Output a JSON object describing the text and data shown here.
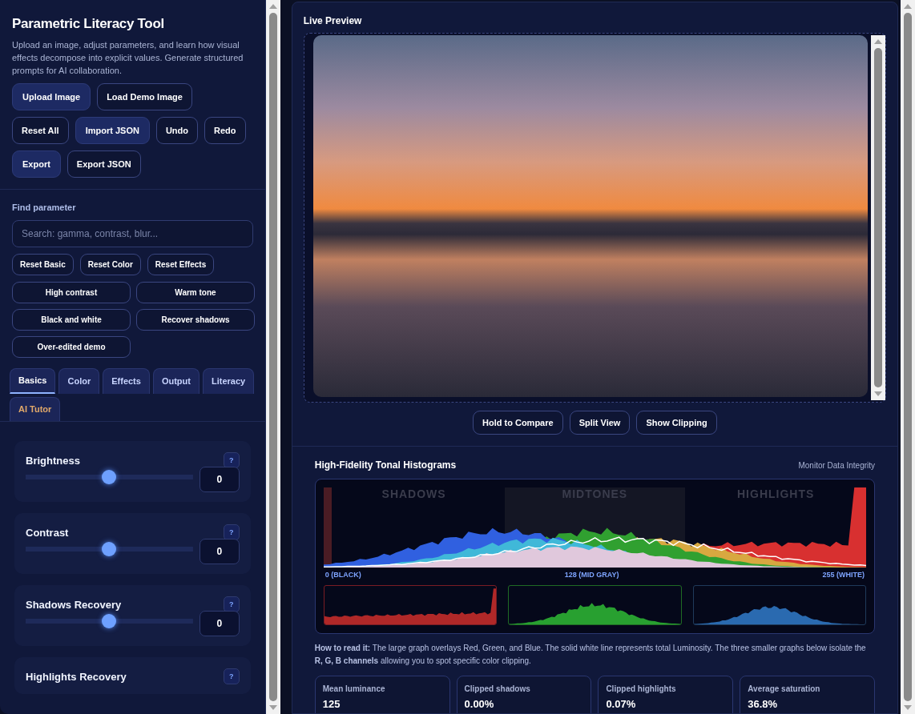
{
  "sidebar": {
    "title": "Parametric Literacy Tool",
    "description": "Upload an image, adjust parameters, and learn how visual effects decompose into explicit values. Generate structured prompts for AI collaboration.",
    "action_rows": [
      [
        {
          "label": "Upload Image",
          "primary": true
        },
        {
          "label": "Load Demo Image",
          "primary": false
        }
      ],
      [
        {
          "label": "Reset All",
          "primary": false
        },
        {
          "label": "Import JSON",
          "primary": true
        },
        {
          "label": "Undo",
          "primary": false
        },
        {
          "label": "Redo",
          "primary": false
        }
      ],
      [
        {
          "label": "Export",
          "primary": true
        },
        {
          "label": "Export JSON",
          "primary": false
        }
      ]
    ],
    "find_label": "Find parameter",
    "search": {
      "placeholder": "Search: gamma, contrast, blur..."
    },
    "reset_buttons": [
      "Reset Basic",
      "Reset Color",
      "Reset Effects"
    ],
    "presets": [
      "High contrast",
      "Warm tone",
      "Black and white",
      "Recover shadows",
      "Over-edited demo"
    ],
    "tabs": [
      {
        "label": "Basics",
        "selected": true
      },
      {
        "label": "Color",
        "selected": false
      },
      {
        "label": "Effects",
        "selected": false
      },
      {
        "label": "Output",
        "selected": false
      },
      {
        "label": "Literacy",
        "selected": false
      },
      {
        "label": "AI Tutor",
        "selected": false
      }
    ],
    "controls": [
      {
        "label": "Brightness",
        "help": "?",
        "level": 0.5,
        "value": "0"
      },
      {
        "label": "Contrast",
        "help": "?",
        "level": 0.5,
        "value": "0"
      },
      {
        "label": "Shadows Recovery",
        "help": "?",
        "level": 0.5,
        "value": "0"
      },
      {
        "label": "Highlights Recovery",
        "help": "?"
      }
    ]
  },
  "preview": {
    "title": "Live Preview",
    "buttons": [
      "Hold to Compare",
      "Split View",
      "Show Clipping"
    ]
  },
  "histograms": {
    "title": "High-Fidelity Tonal Histograms",
    "note": "Monitor Data Integrity",
    "zones": [
      "SHADOWS",
      "MIDTONES",
      "HIGHLIGHTS"
    ],
    "axis_labels": [
      "0 (BLACK)",
      "128 (MID GRAY)",
      "255 (WHITE)"
    ],
    "help_text": "**How to read it:** The large graph overlays Red, Green, and Blue. The solid white line represents total Luminosity. The three smaller graphs below isolate the **R, G, B channels** allowing you to spot specific color clipping.",
    "stats": [
      {
        "label": "Mean luminance",
        "value": "125"
      },
      {
        "label": "Clipped shadows",
        "value": "0.00%"
      },
      {
        "label": "Clipped highlights",
        "value": "0.07%"
      },
      {
        "label": "Average saturation",
        "value": "36.8%"
      }
    ]
  }
}
